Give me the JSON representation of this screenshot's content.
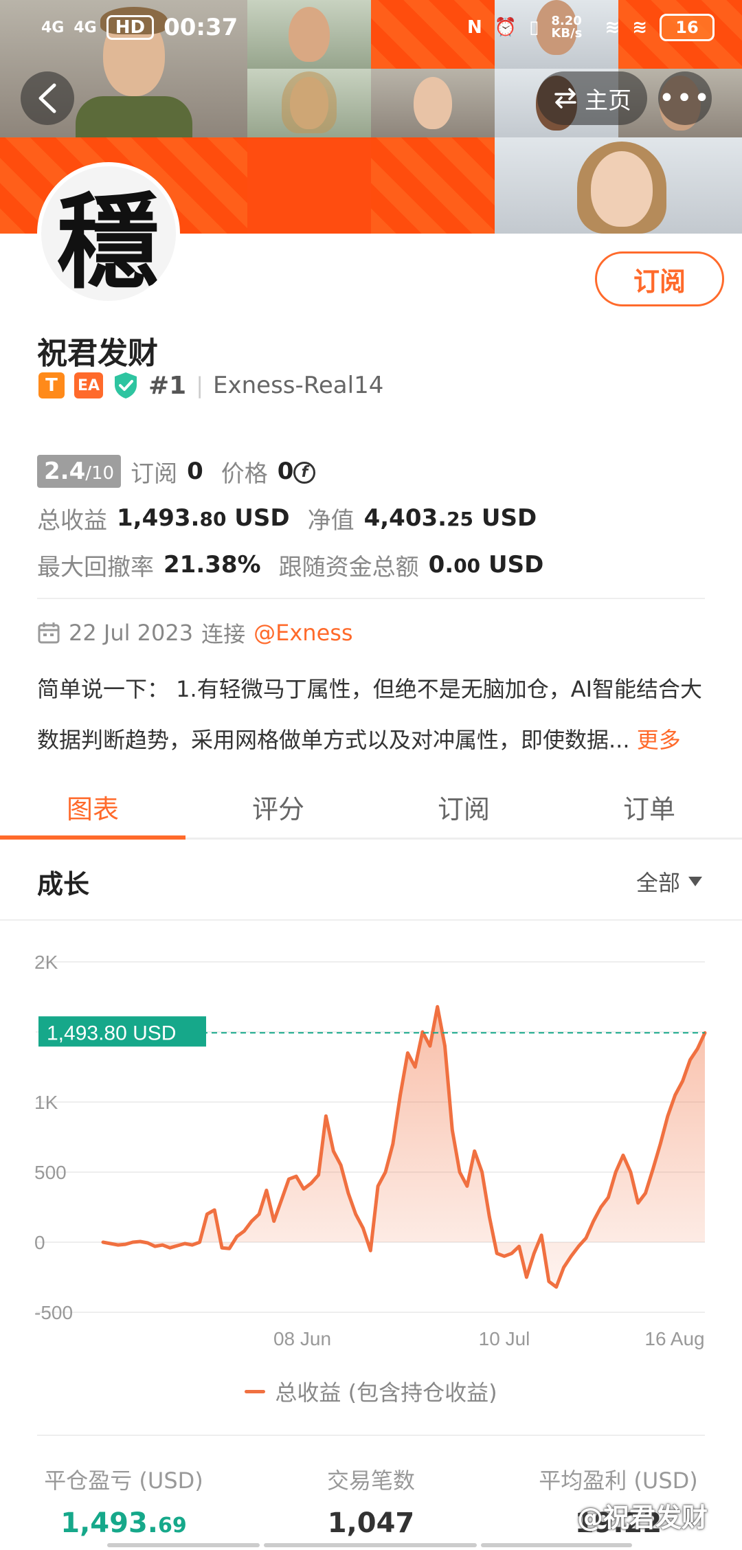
{
  "status_bar": {
    "signal1": "4G",
    "signal2": "4G",
    "hd": "HD",
    "time": "00:37",
    "net_speed": "8.20 KB/s",
    "battery": "16"
  },
  "nav": {
    "back_icon": "chevron-left-icon",
    "home_label": "主页",
    "home_icon": "swap-icon",
    "more_icon": "more-dots-icon"
  },
  "profile": {
    "avatar_char": "穩",
    "subscribe_label": "订阅",
    "name": "祝君发财",
    "tag_t": "T",
    "tag_ea": "EA",
    "rank": "#1",
    "separator": "|",
    "account": "Exness-Real14"
  },
  "stats": {
    "score": "2.4",
    "score_max": "/10",
    "subscribe_label": "订阅",
    "subscribe_count": "0",
    "price_label": "价格",
    "price_value": "0",
    "price_coin": "f",
    "total_profit_label": "总收益",
    "total_profit_int": "1,493.",
    "total_profit_dec": "80",
    "total_profit_unit": "USD",
    "equity_label": "净值",
    "equity_int": "4,403.",
    "equity_dec": "25",
    "equity_unit": "USD",
    "drawdown_label": "最大回撤率",
    "drawdown_value": "21.38%",
    "follow_label": "跟随资金总额",
    "follow_int": "0.",
    "follow_dec": "00",
    "follow_unit": "USD"
  },
  "connect": {
    "date": "22 Jul 2023",
    "connect_label": "连接",
    "broker": "@Exness"
  },
  "description": {
    "line1": "简单说一下： 1.有轻微马丁属性，但绝不是无脑加仓，AI智能结合大",
    "line2": "数据判断趋势，采用网格做单方式以及对冲属性，即使数据...",
    "more": "更多"
  },
  "tabs": [
    {
      "label": "图表",
      "active": true
    },
    {
      "label": "评分",
      "active": false
    },
    {
      "label": "订阅",
      "active": false
    },
    {
      "label": "订单",
      "active": false
    }
  ],
  "chart_section": {
    "title": "成长",
    "filter_label": "全部"
  },
  "chart_data": {
    "type": "area",
    "y_ticks": [
      "2K",
      "1K",
      "500",
      "0",
      "-500"
    ],
    "x_ticks": [
      "08 Jun",
      "10 Jul",
      "16 Aug"
    ],
    "ylim": [
      -500,
      2000
    ],
    "current_value_label": "1,493.80 USD",
    "current_value": 1493.8,
    "series": [
      {
        "name": "总收益 (包含持仓收益)",
        "color": "#f07040",
        "values": [
          0,
          -10,
          -20,
          -15,
          0,
          5,
          -5,
          -30,
          -20,
          -40,
          -25,
          -10,
          -20,
          0,
          200,
          230,
          -40,
          -45,
          40,
          80,
          150,
          200,
          370,
          150,
          300,
          450,
          470,
          380,
          420,
          480,
          900,
          650,
          550,
          350,
          200,
          100,
          -60,
          400,
          500,
          700,
          1050,
          1350,
          1250,
          1500,
          1400,
          1680,
          1400,
          800,
          500,
          400,
          650,
          500,
          180,
          -80,
          -100,
          -80,
          -30,
          -250,
          -80,
          50,
          -280,
          -320,
          -180,
          -100,
          -30,
          30,
          150,
          250,
          320,
          500,
          620,
          500,
          280,
          350,
          520,
          700,
          900,
          1050,
          1150,
          1300,
          1380,
          1493.8
        ]
      }
    ]
  },
  "legend": {
    "label": "总收益 (包含持仓收益)"
  },
  "bottom_stats": [
    {
      "label": "平仓盈亏 (USD)",
      "int": "1,493.",
      "dec": "69",
      "green": true
    },
    {
      "label": "交易笔数",
      "int": "1,047",
      "dec": "",
      "green": false
    },
    {
      "label": "平均盈利 (USD)",
      "int": "19.22",
      "dec": "",
      "green": false
    }
  ],
  "watermark": "@祝君发财"
}
